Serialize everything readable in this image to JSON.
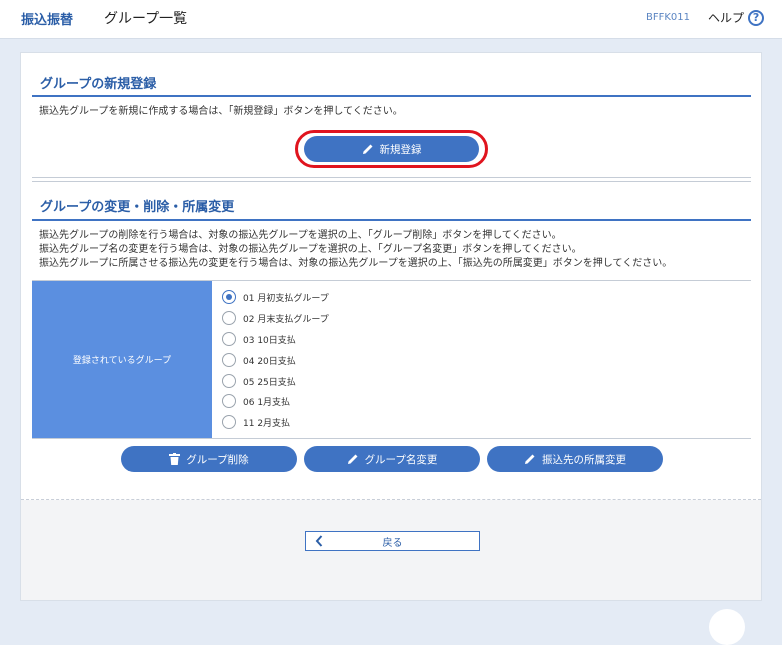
{
  "header": {
    "brand": "振込振替",
    "title": "グループ一覧",
    "screen_id": "BFFK011",
    "help_label": "ヘルプ",
    "help_icon": "?"
  },
  "new_section": {
    "title": "グループの新規登録",
    "description": "振込先グループを新規に作成する場合は、「新規登録」ボタンを押してください。",
    "button_label": "新規登録"
  },
  "edit_section": {
    "title": "グループの変更・削除・所属変更",
    "descriptions": [
      "振込先グループの削除を行う場合は、対象の振込先グループを選択の上、「グループ削除」ボタンを押してください。",
      "振込先グループ名の変更を行う場合は、対象の振込先グループを選択の上、「グループ名変更」ボタンを押してください。",
      "振込先グループに所属させる振込先の変更を行う場合は、対象の振込先グループを選択の上、「振込先の所属変更」ボタンを押してください。"
    ],
    "table_header": "登録されているグループ",
    "groups": [
      {
        "label": "01 月初支払グループ",
        "checked": true
      },
      {
        "label": "02 月末支払グループ",
        "checked": false
      },
      {
        "label": "03 10日支払",
        "checked": false
      },
      {
        "label": "04 20日支払",
        "checked": false
      },
      {
        "label": "05 25日支払",
        "checked": false
      },
      {
        "label": "06 1月支払",
        "checked": false
      },
      {
        "label": "11 2月支払",
        "checked": false
      }
    ],
    "buttons": {
      "delete": "グループ削除",
      "rename": "グループ名変更",
      "membership": "振込先の所属変更"
    }
  },
  "footer": {
    "back_label": "戻る"
  },
  "colors": {
    "accent": "#3f73c3",
    "table_header_bg": "#5b8fe0",
    "highlight": "#e0141e",
    "page_bg": "#e4ebf5"
  }
}
